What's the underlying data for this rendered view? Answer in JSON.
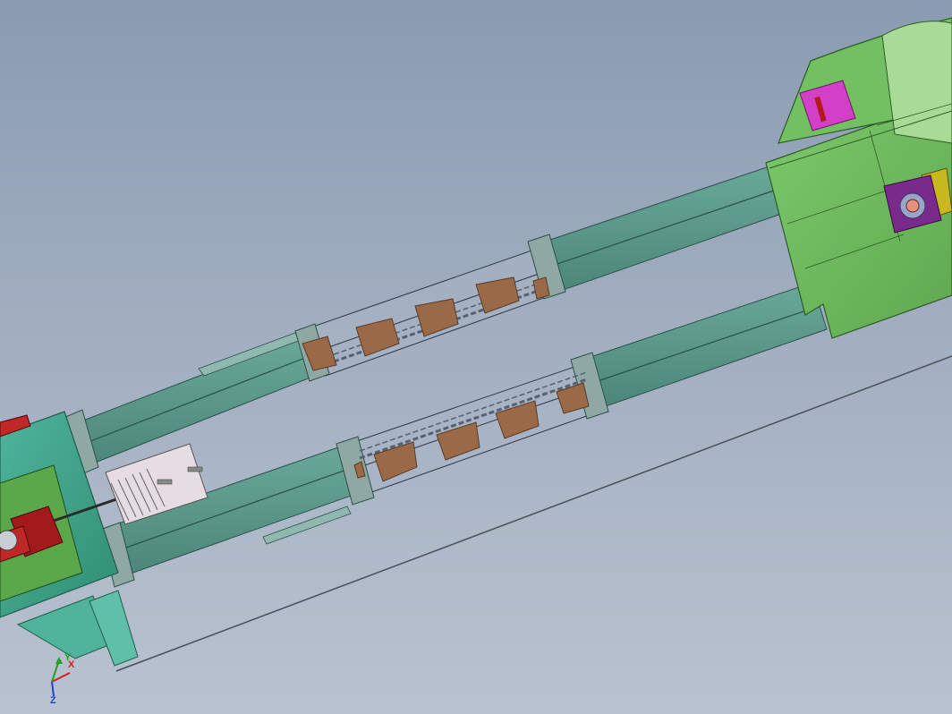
{
  "viewport": {
    "background_top": "#8a9bb1",
    "background_bottom": "#b9c2d0"
  },
  "colors": {
    "head_housing": "#6fba5e",
    "head_housing_dark": "#4f9a44",
    "casing": "#5b9a8c",
    "casing_dark": "#3f7a6e",
    "boot_housing": "#43a98f",
    "motor": "#a31a1a",
    "bucket": "#9a6a48",
    "inspection_door": "#d43fc7",
    "bearing": "#7a2a8a",
    "bearing_plate": "#c8b820",
    "flange": "#8fa8a4"
  },
  "triad": {
    "x_label": "X",
    "y_label": "Y",
    "z_label": "Z",
    "x_color": "#d02020",
    "y_color": "#20a020",
    "z_color": "#2040d0"
  }
}
